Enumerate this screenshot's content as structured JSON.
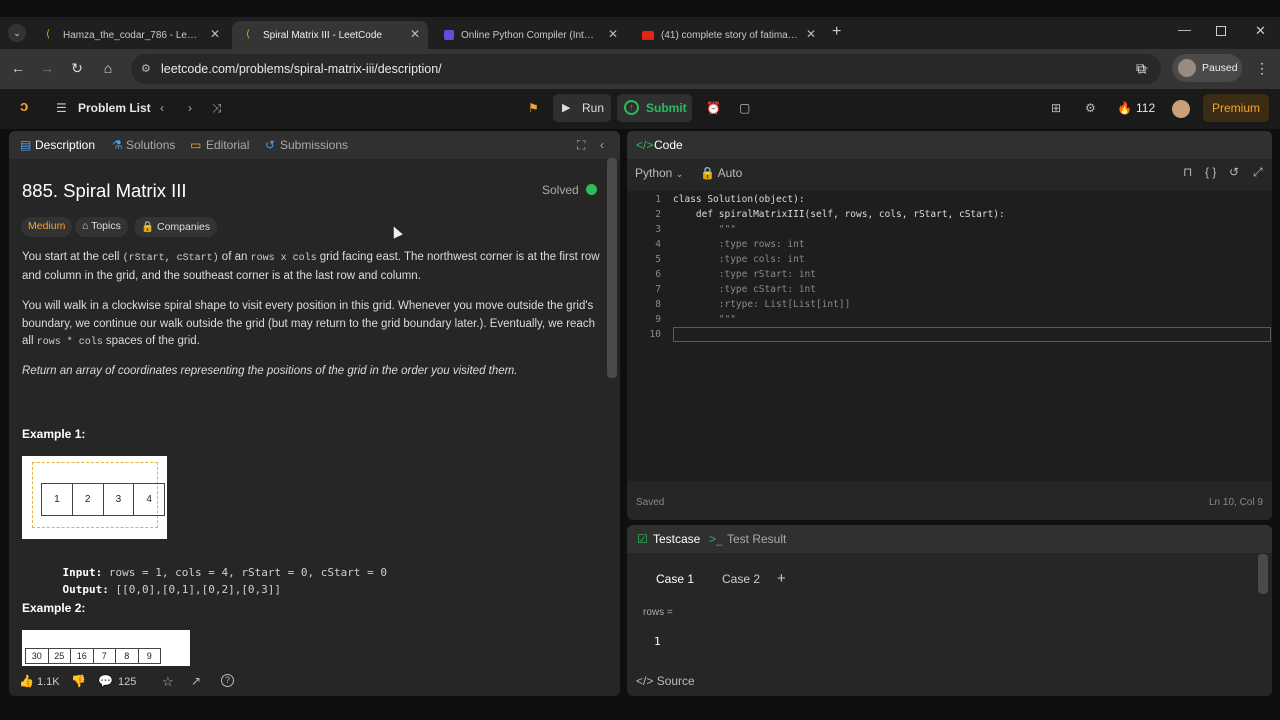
{
  "browser": {
    "tabs": [
      {
        "title": "Hamza_the_codar_786 - LeetCode",
        "active": false
      },
      {
        "title": "Spiral Matrix III - LeetCode",
        "active": true
      },
      {
        "title": "Online Python Compiler (Interpreter)",
        "active": false
      },
      {
        "title": "(41) complete story of fatima jinnah",
        "active": false
      }
    ],
    "url": "leetcode.com/problems/spiral-matrix-iii/description/",
    "profile_status": "Paused"
  },
  "header": {
    "problem_list": "Problem List",
    "run": "Run",
    "submit": "Submit",
    "streak": "112",
    "premium": "Premium"
  },
  "desc_tabs": [
    "Description",
    "Solutions",
    "Editorial",
    "Submissions"
  ],
  "problem": {
    "title": "885. Spiral Matrix III",
    "status": "Solved",
    "difficulty": "Medium",
    "topics": "Topics",
    "companies": "Companies",
    "p1": {
      "a": "You start at the cell ",
      "c1": "(rStart, cStart)",
      "b": " of an ",
      "c2": "rows x cols",
      "c": " grid facing east. The northwest corner is at the first row and column in the grid, and the southeast corner is at the last row and column."
    },
    "p2": {
      "a": "You will walk in a clockwise spiral shape to visit every position in this grid. Whenever you move outside the grid's boundary, we continue our walk outside the grid (but may return to the grid boundary later.). Eventually, we reach all ",
      "c1": "rows * cols",
      "b": " spaces of the grid."
    },
    "p3": {
      "a": "Return ",
      "b": "an array of coordinates representing the positions of the grid in the order you visited them."
    },
    "example1": {
      "title": "Example 1:",
      "cells": [
        "1",
        "2",
        "3",
        "4"
      ],
      "input_label": "Input:",
      "input": "rows = 1, cols = 4, rStart = 0, cStart = 0",
      "output_label": "Output:",
      "output": "[[0,0],[0,1],[0,2],[0,3]]"
    },
    "example2": {
      "title": "Example 2:",
      "cells": [
        "30",
        "25",
        "16",
        "7",
        "8",
        "9"
      ]
    }
  },
  "footer": {
    "likes": "1.1K",
    "comments": "125"
  },
  "code": {
    "tab": "Code",
    "language": "Python",
    "mode": "Auto",
    "lines": [
      "class Solution(object):",
      "    def spiralMatrixIII(self, rows, cols, rStart, cStart):",
      "        \"\"\"",
      "        :type rows: int",
      "        :type cols: int",
      "        :type rStart: int",
      "        :type cStart: int",
      "        :rtype: List[List[int]]",
      "        \"\"\"",
      ""
    ],
    "line_numbers": [
      "1",
      "2",
      "3",
      "4",
      "5",
      "6",
      "7",
      "8",
      "9",
      "10"
    ],
    "saved": "Saved",
    "cursor": "Ln 10, Col 9"
  },
  "testcase": {
    "tab": "Testcase",
    "result_tab": "Test Result",
    "cases": [
      "Case 1",
      "Case 2"
    ],
    "add": "+",
    "var_label": "rows =",
    "var_value": "1",
    "source": "Source"
  }
}
